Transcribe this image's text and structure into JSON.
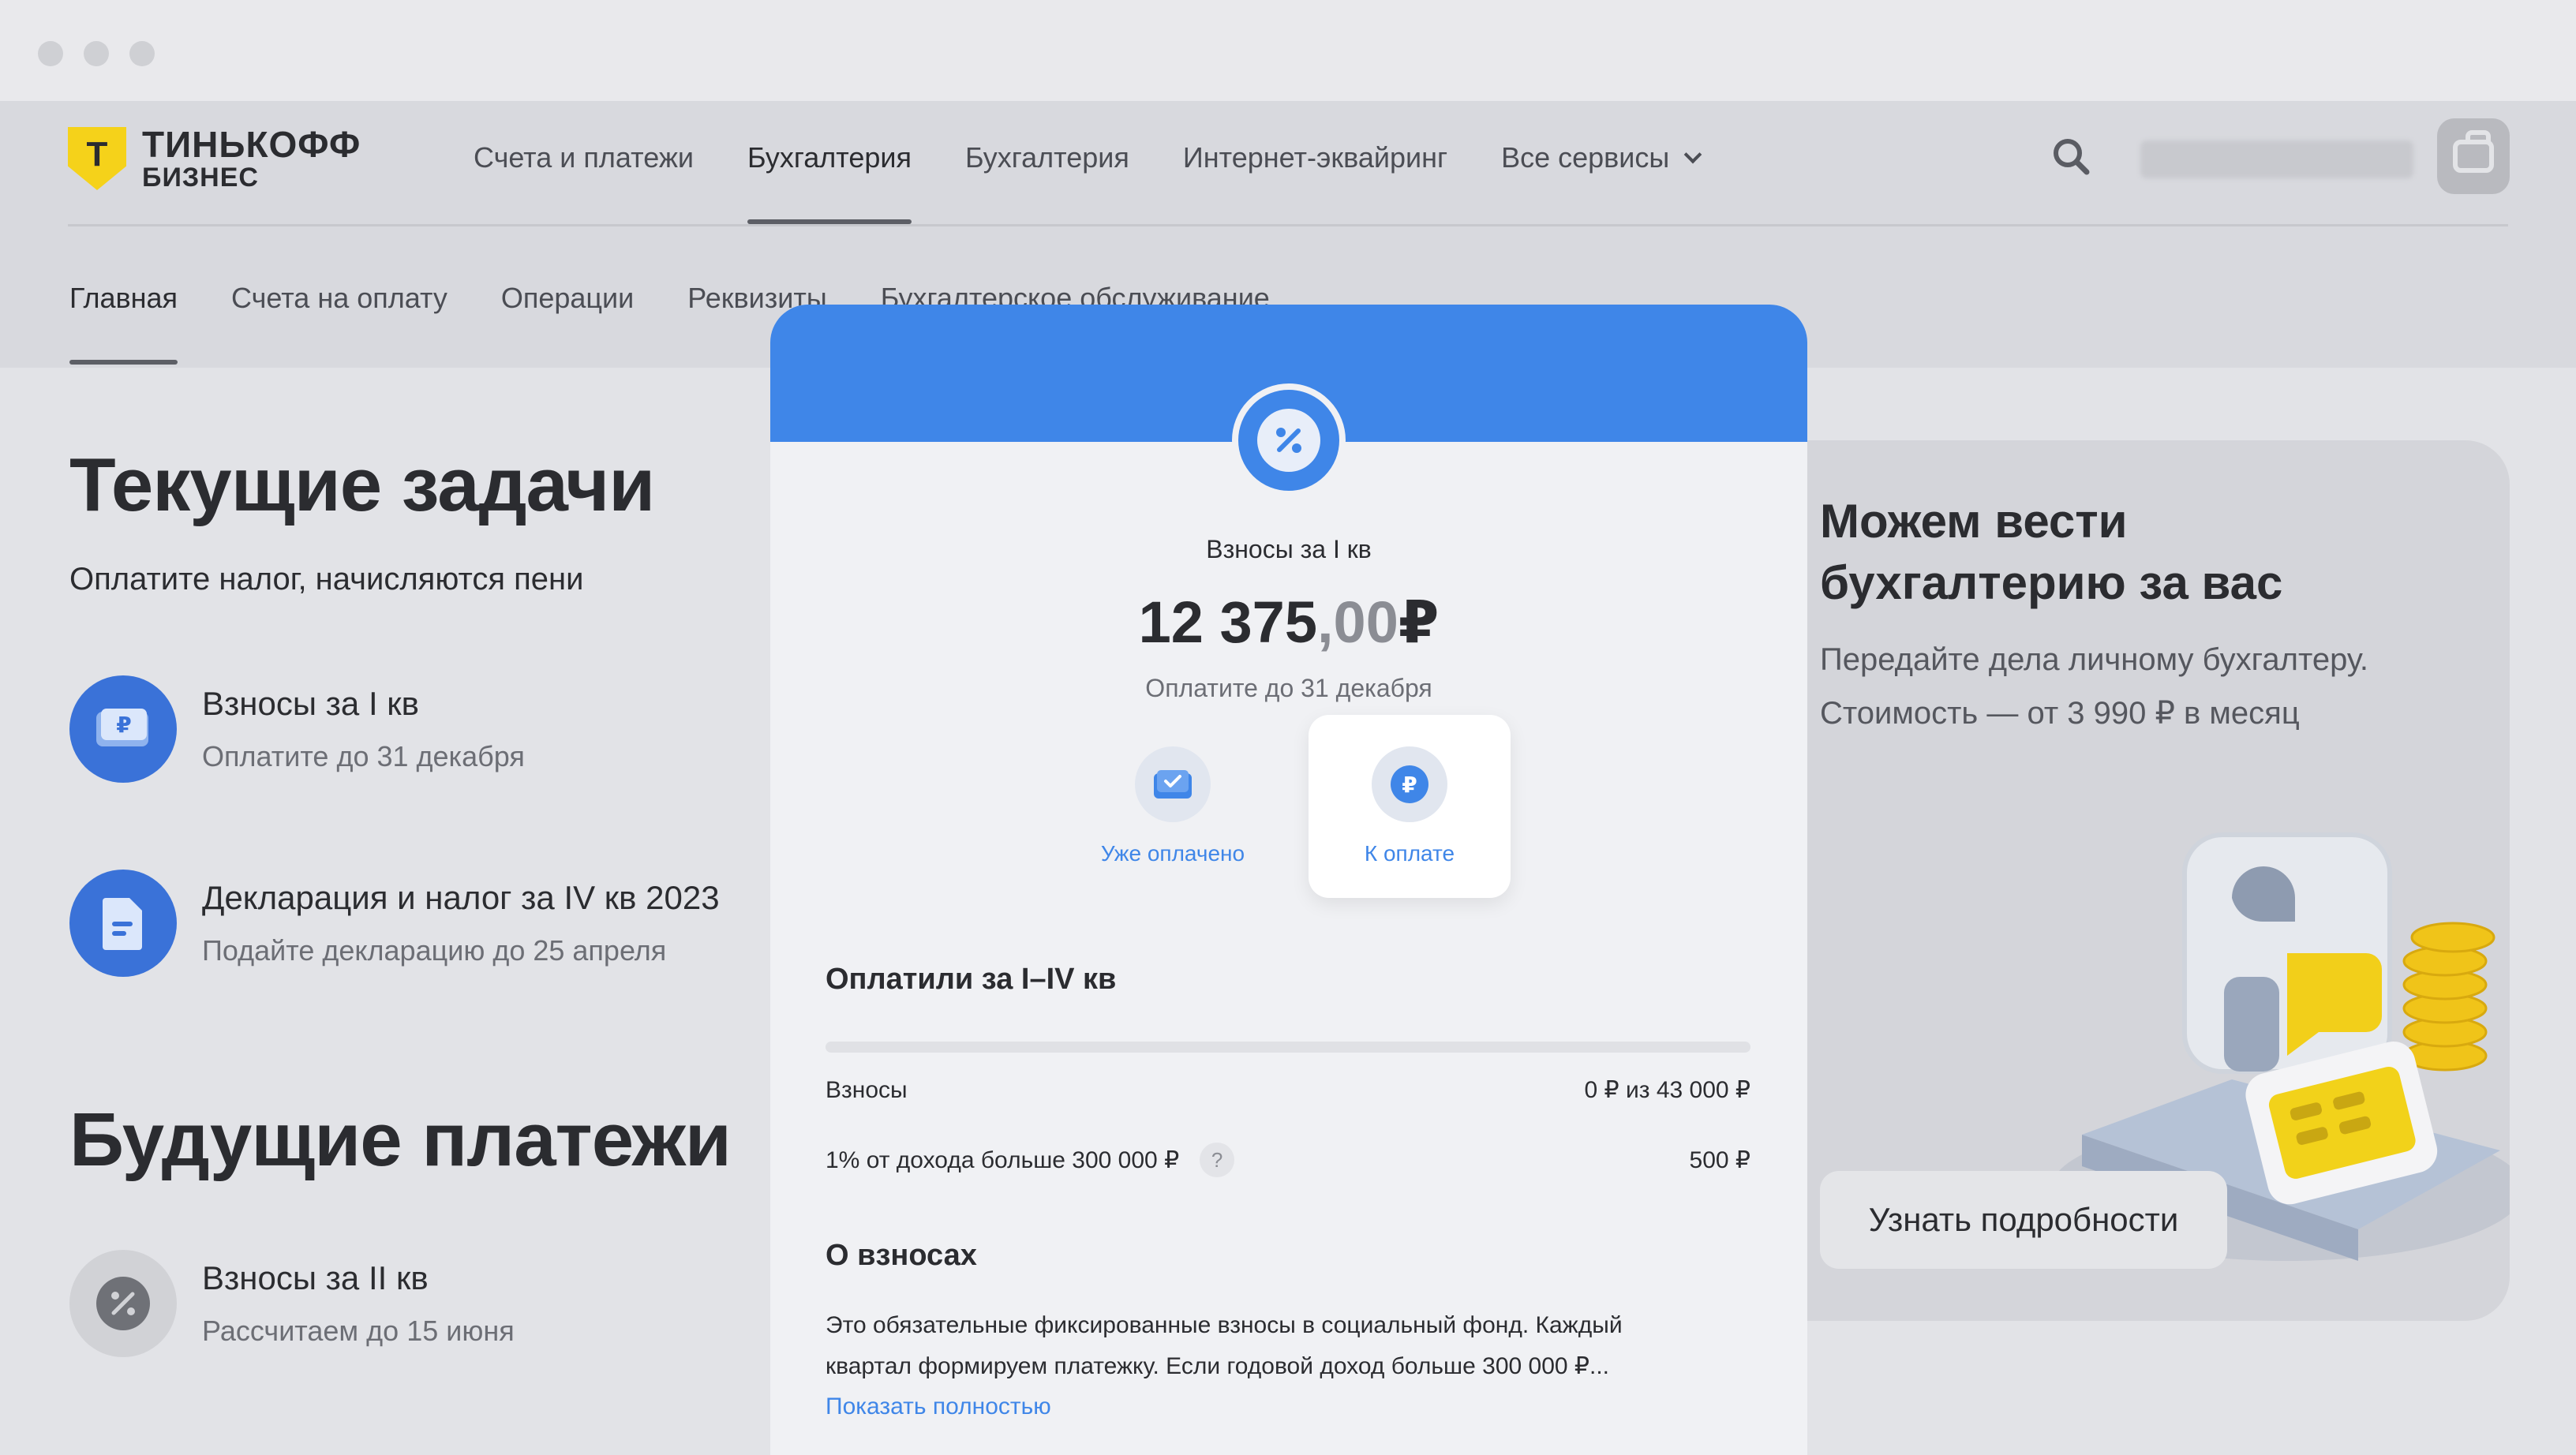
{
  "brand": {
    "line1": "ТИНЬКОФФ",
    "line2": "БИЗНЕС",
    "mark": "Т"
  },
  "topnav": {
    "items": [
      {
        "label": "Счета и платежи"
      },
      {
        "label": "Бухгалтерия"
      },
      {
        "label": "Бухгалтерия"
      },
      {
        "label": "Интернет-эквайринг"
      },
      {
        "label": "Все сервисы"
      }
    ],
    "active_index": 1
  },
  "subnav": {
    "items": [
      {
        "label": "Главная"
      },
      {
        "label": "Счета на оплату"
      },
      {
        "label": "Операции"
      },
      {
        "label": "Реквизиты"
      },
      {
        "label": "Бухгалтерское обслуживание"
      }
    ],
    "active_index": 0
  },
  "current": {
    "title": "Текущие задачи",
    "subtitle": "Оплатите налог, начисляются пени",
    "tasks": [
      {
        "title": "Взносы за I кв",
        "note": "Оплатите до 31 декабря",
        "icon": "ruble-card-icon"
      },
      {
        "title": "Декларация и налог за IV кв 2023",
        "note": "Подайте декларацию до 25 апреля",
        "icon": "document-icon"
      }
    ]
  },
  "future": {
    "title": "Будущие платежи",
    "tasks": [
      {
        "title": "Взносы за II кв",
        "note": "Рассчитаем до 15 июня",
        "icon": "percent-icon"
      }
    ]
  },
  "promo": {
    "title_line1": "Можем вести",
    "title_line2": "бухгалтерию за вас",
    "text_line1": "Передайте дела личному бухгалтеру.",
    "text_line2": "Стоимость — от 3 990 ₽ в месяц",
    "button": "Узнать подробности"
  },
  "modal": {
    "label": "Взносы за I кв",
    "amount_int": "12 375",
    "amount_frac": ",00",
    "currency": "₽",
    "due": "Оплатите до 31 декабря",
    "option_paid": "Уже оплачено",
    "option_topay": "К оплате",
    "paid_section": "Оплатили за I–IV кв",
    "progress_fraction": 0,
    "rows": [
      {
        "label": "Взносы",
        "value": "0 ₽ из 43 000 ₽"
      },
      {
        "label": "1% от дохода больше 300 000 ₽",
        "value": "500 ₽",
        "help": "?"
      }
    ],
    "about_title": "О взносах",
    "about_line1": "Это обязательные фиксированные взносы в социальный фонд. Каждый",
    "about_line2": "квартал формируем платежку. Если годовой доход больше 300 000 ₽...",
    "show_more": "Показать полностью"
  },
  "colors": {
    "accent_blue": "#3f86e8",
    "brand_yellow": "#f5d21a",
    "icon_blue": "#3a72d8"
  }
}
